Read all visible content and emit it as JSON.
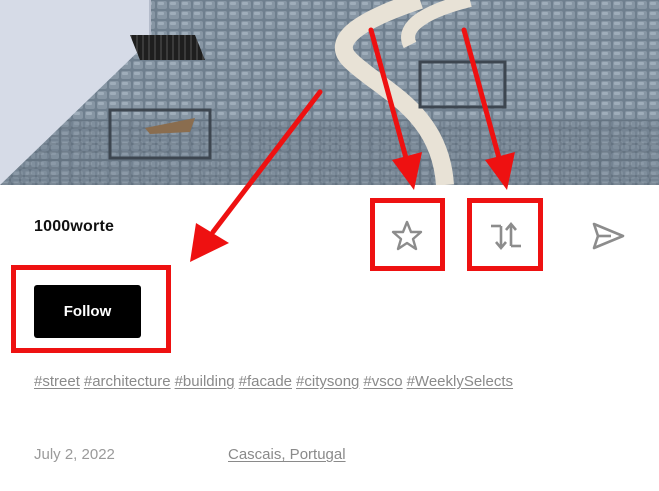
{
  "post": {
    "username": "1000worte",
    "follow_label": "Follow",
    "tags": [
      "#street",
      "#architecture",
      "#building",
      "#facade",
      "#citysong",
      "#vsco",
      "#WeeklySelects"
    ],
    "date": "July 2, 2022",
    "location": "Cascais, Portugal"
  },
  "icons": {
    "favorite": "star-icon",
    "republish": "republish-arrows-icon",
    "share": "send-icon"
  },
  "colors": {
    "annotation": "#ee1111",
    "button_bg": "#000000",
    "muted_text": "#8a8a8a"
  }
}
